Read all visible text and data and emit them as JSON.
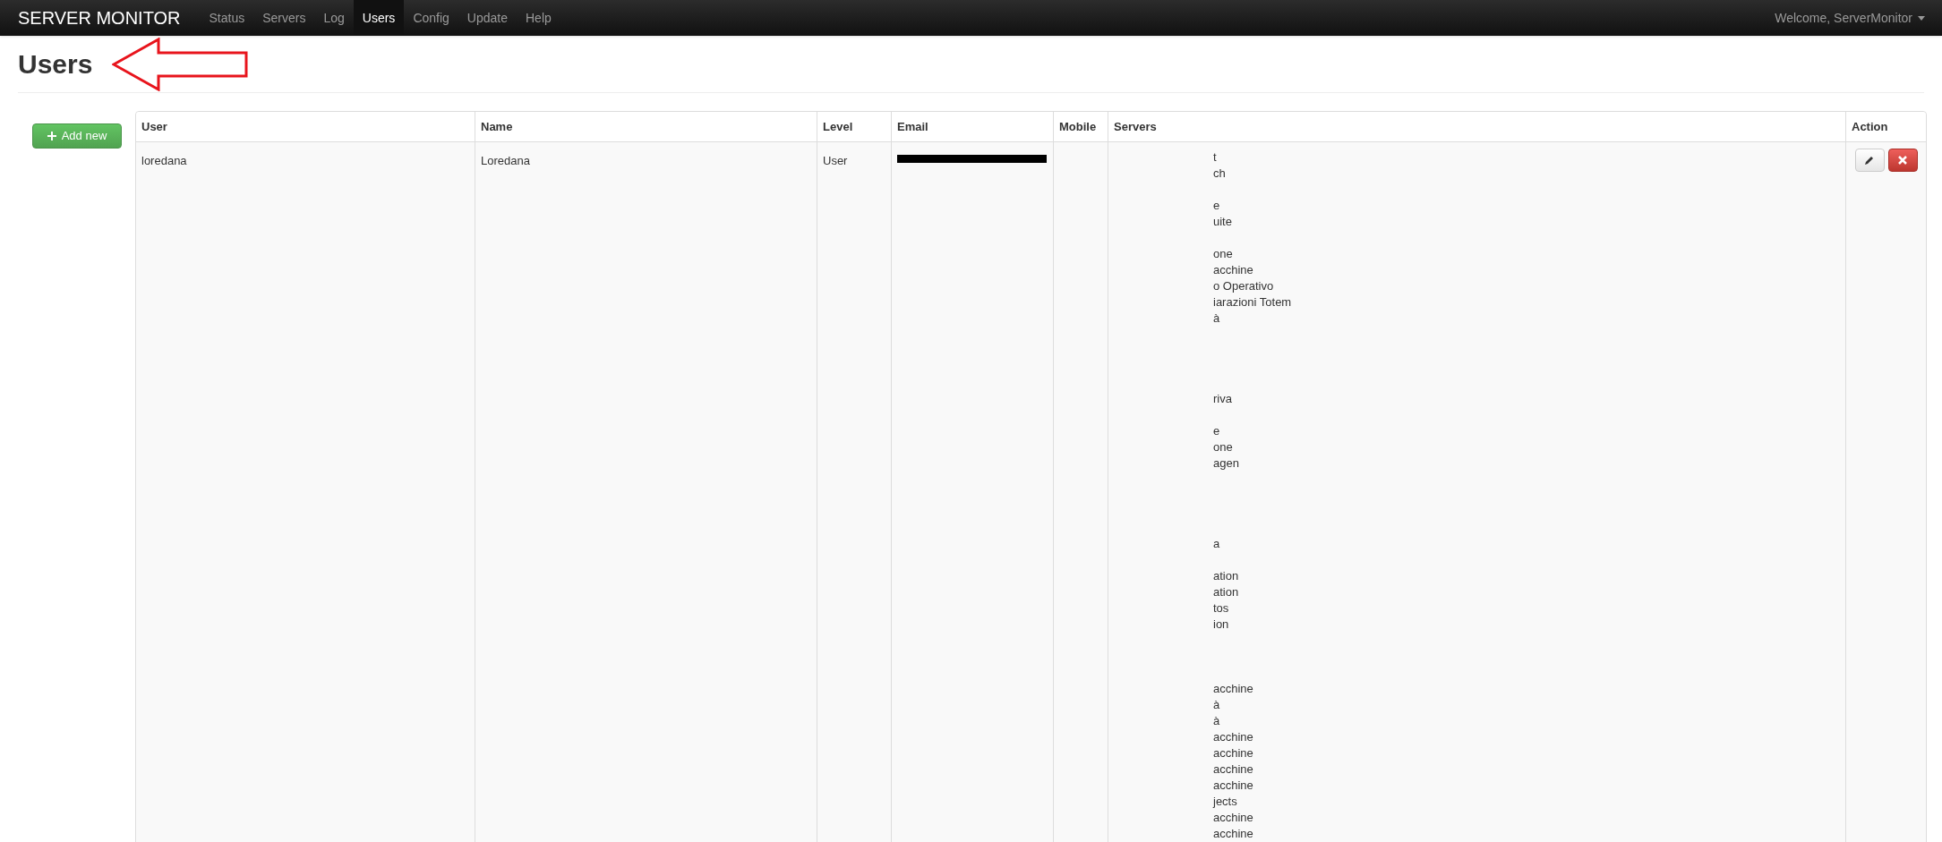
{
  "navbar": {
    "brand": "SERVER MONITOR",
    "items": [
      {
        "label": "Status",
        "selected": false
      },
      {
        "label": "Servers",
        "selected": false
      },
      {
        "label": "Log",
        "selected": false
      },
      {
        "label": "Users",
        "selected": true
      },
      {
        "label": "Config",
        "selected": false
      },
      {
        "label": "Update",
        "selected": false
      },
      {
        "label": "Help",
        "selected": false
      }
    ],
    "user_menu": "Welcome, ServerMonitor"
  },
  "page_title": "Users",
  "annotation": {
    "kind": "arrow"
  },
  "add_button": "Add new",
  "table": {
    "columns": [
      "User",
      "Name",
      "Level",
      "Email",
      "Mobile",
      "Servers",
      "Action"
    ],
    "rows": [
      {
        "user": "loredana",
        "name": "Loredana",
        "level": "User",
        "email": {
          "redacted": true
        },
        "servers": [
          {
            "kind": "text",
            "text": "t"
          },
          {
            "kind": "text",
            "text": "ch"
          },
          {
            "kind": "hidden"
          },
          {
            "kind": "text",
            "text": "e"
          },
          {
            "kind": "text",
            "text": "uite"
          },
          {
            "kind": "hidden"
          },
          {
            "kind": "text",
            "text": "one"
          },
          {
            "kind": "text",
            "text": "acchine"
          },
          {
            "kind": "text",
            "text": "o Operativo"
          },
          {
            "kind": "text",
            "text": "iarazioni Totem"
          },
          {
            "kind": "text",
            "text": "à"
          },
          {
            "kind": "hidden"
          },
          {
            "kind": "hidden"
          },
          {
            "kind": "hidden"
          },
          {
            "kind": "hidden"
          },
          {
            "kind": "text",
            "text": "riva"
          },
          {
            "kind": "hidden"
          },
          {
            "kind": "text",
            "text": "e"
          },
          {
            "kind": "text",
            "text": "one"
          },
          {
            "kind": "text",
            "text": "agen"
          },
          {
            "kind": "hidden"
          },
          {
            "kind": "hidden"
          },
          {
            "kind": "hidden"
          },
          {
            "kind": "hidden"
          },
          {
            "kind": "text",
            "text": "a"
          },
          {
            "kind": "hidden"
          },
          {
            "kind": "text",
            "text": "ation"
          },
          {
            "kind": "text",
            "text": "ation"
          },
          {
            "kind": "text",
            "text": "tos"
          },
          {
            "kind": "text",
            "text": "ion"
          },
          {
            "kind": "hidden"
          },
          {
            "kind": "hidden"
          },
          {
            "kind": "hidden"
          },
          {
            "kind": "text",
            "text": "acchine"
          },
          {
            "kind": "text",
            "text": "à"
          },
          {
            "kind": "text",
            "text": "à"
          },
          {
            "kind": "text",
            "text": "acchine"
          },
          {
            "kind": "text",
            "text": "acchine"
          },
          {
            "kind": "text",
            "text": "acchine"
          },
          {
            "kind": "text",
            "text": "acchine"
          },
          {
            "kind": "text",
            "text": "jects"
          },
          {
            "kind": "text",
            "text": "acchine"
          },
          {
            "kind": "text",
            "text": "acchine"
          }
        ]
      }
    ]
  }
}
